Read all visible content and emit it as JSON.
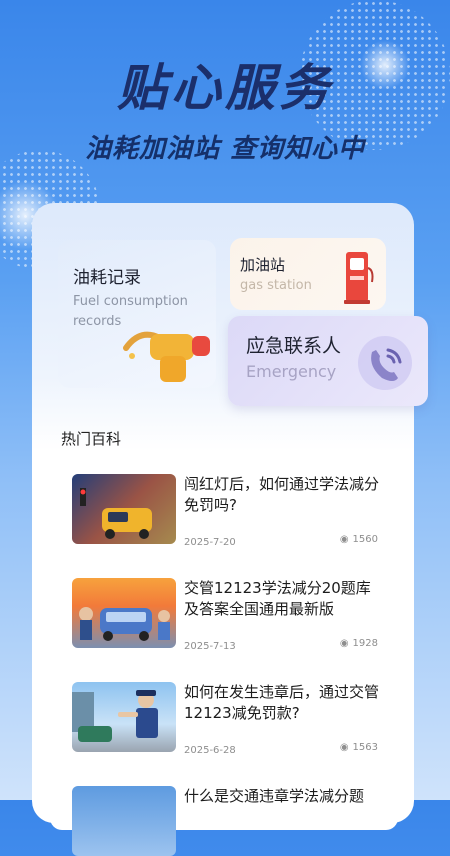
{
  "hero": {
    "title": "贴心服务",
    "subtitle": "油耗加油站 查询知心中"
  },
  "services": {
    "fuel": {
      "title": "油耗记录",
      "subtitle_line1": "Fuel consumption",
      "subtitle_line2": "records"
    },
    "gas": {
      "title": "加油站",
      "subtitle": "gas station"
    },
    "emergency": {
      "title": "应急联系人",
      "subtitle": "Emergency"
    }
  },
  "encyclopedia": {
    "section_title": "热门百科",
    "articles": [
      {
        "title": "闯红灯后，如何通过学法减分免罚吗?",
        "date": "2025-7-20",
        "views": "1560"
      },
      {
        "title": "交管12123学法减分20题库及答案全国通用最新版",
        "date": "2025-7-13",
        "views": "1928"
      },
      {
        "title": "如何在发生违章后，通过交管12123减免罚款?",
        "date": "2025-6-28",
        "views": "1563"
      },
      {
        "title": "什么是交通违章学法减分题",
        "date": "",
        "views": ""
      }
    ]
  },
  "icons": [
    "fuel-nozzle-icon",
    "gas-pump-icon",
    "phone-icon",
    "eye-icon"
  ],
  "colors": {
    "accent": "#3a86ea",
    "title_dark": "#1b2f6b",
    "emergency_card": "#dcd9f7",
    "gas_card": "#fbf3ea"
  }
}
